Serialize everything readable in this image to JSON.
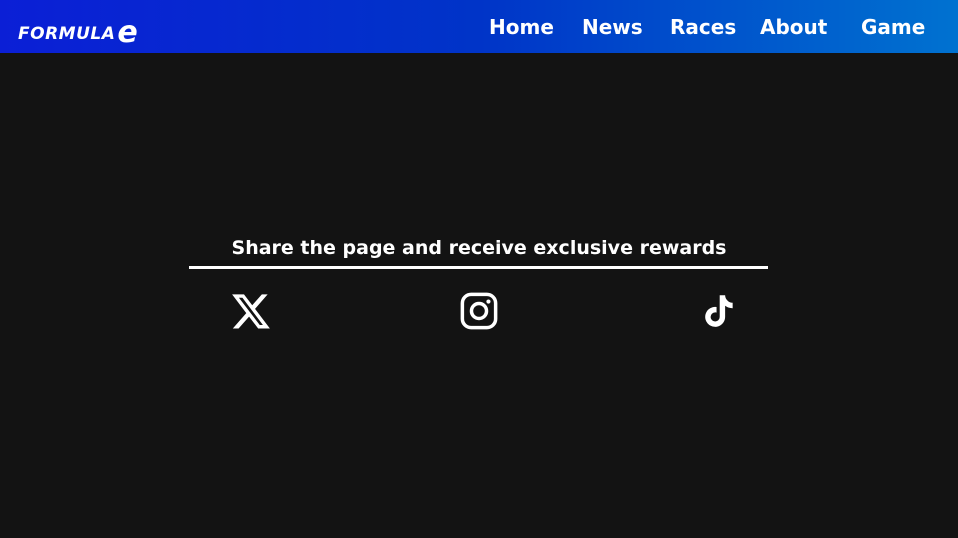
{
  "brand": {
    "name": "FORMULA",
    "mark": "e"
  },
  "nav": {
    "items": [
      "Home",
      "News",
      "Races",
      "About",
      "Game"
    ]
  },
  "share": {
    "heading": "Share the page and receive exclusive rewards",
    "icons": [
      "x-icon",
      "instagram-icon",
      "tiktok-icon"
    ]
  }
}
